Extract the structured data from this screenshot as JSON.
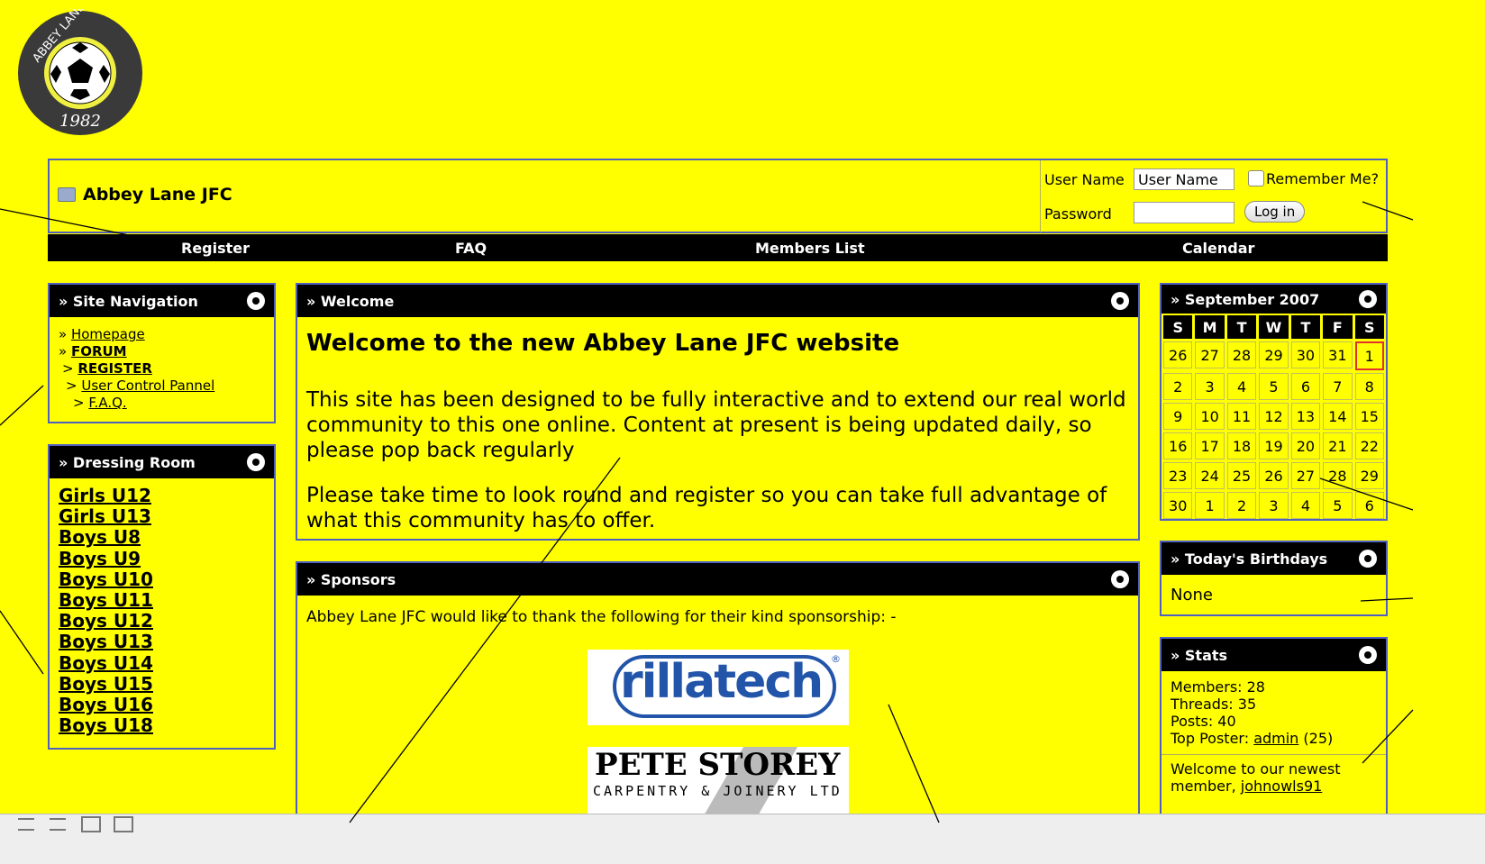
{
  "header": {
    "site_title": "Abbey Lane JFC",
    "login": {
      "username_label": "User Name",
      "username_value": "User Name",
      "remember_label": "Remember Me?",
      "password_label": "Password",
      "login_button": "Log in"
    },
    "nav": [
      "Register",
      "FAQ",
      "Members List",
      "Calendar"
    ]
  },
  "logo": {
    "top_text": "ABBEY LANE J.F.C.",
    "year": "1982"
  },
  "site_navigation": {
    "title": "» Site Navigation",
    "items": [
      {
        "prefix": "» ",
        "label": "Homepage"
      },
      {
        "prefix": "» ",
        "label": "FORUM"
      },
      {
        "prefix": " > ",
        "label": "REGISTER"
      },
      {
        "prefix": "  > ",
        "label": "User Control Pannel"
      },
      {
        "prefix": "   > ",
        "label": "F.A.Q."
      }
    ]
  },
  "dressing_room": {
    "title": "» Dressing Room",
    "items": [
      "Girls U12",
      "Girls U13",
      "Boys U8",
      "Boys U9",
      "Boys U10",
      "Boys U11",
      "Boys U12",
      "Boys U13",
      "Boys U14",
      "Boys U15",
      "Boys U16",
      "Boys U18"
    ]
  },
  "welcome": {
    "title": "» Welcome",
    "heading": "Welcome to the new Abbey Lane JFC website",
    "para1": "This site has been designed to be fully interactive and to extend our real world community to this one online. Content at present is being updated daily, so please pop back regularly",
    "para2": "Please take time to look round and register so you can take full advantage of what this community has to offer."
  },
  "sponsors": {
    "title": "» Sponsors",
    "intro": "Abbey Lane JFC would like to thank the following for their kind sponsorship: -",
    "sponsor1": "rillatech",
    "sponsor1_reg": "®",
    "sponsor2_name": "PETE STOREY",
    "sponsor2_sub": "CARPENTRY & JOINERY LTD"
  },
  "calendar": {
    "title": "» September 2007",
    "days": [
      "S",
      "M",
      "T",
      "W",
      "T",
      "F",
      "S"
    ],
    "weeks": [
      [
        "26",
        "27",
        "28",
        "29",
        "30",
        "31",
        "1"
      ],
      [
        "2",
        "3",
        "4",
        "5",
        "6",
        "7",
        "8"
      ],
      [
        "9",
        "10",
        "11",
        "12",
        "13",
        "14",
        "15"
      ],
      [
        "16",
        "17",
        "18",
        "19",
        "20",
        "21",
        "22"
      ],
      [
        "23",
        "24",
        "25",
        "26",
        "27",
        "28",
        "29"
      ],
      [
        "30",
        "1",
        "2",
        "3",
        "4",
        "5",
        "6"
      ]
    ],
    "today": "1"
  },
  "birthdays": {
    "title": "» Today's Birthdays",
    "value": "None"
  },
  "stats": {
    "title": "» Stats",
    "members": "Members: 28",
    "threads": "Threads: 35",
    "posts": "Posts: 40",
    "top_poster_label": "Top Poster:",
    "top_poster_name": "admin",
    "top_poster_count": "(25)",
    "newest_label": "Welcome to our newest member,",
    "newest_name": "johnowls91"
  }
}
